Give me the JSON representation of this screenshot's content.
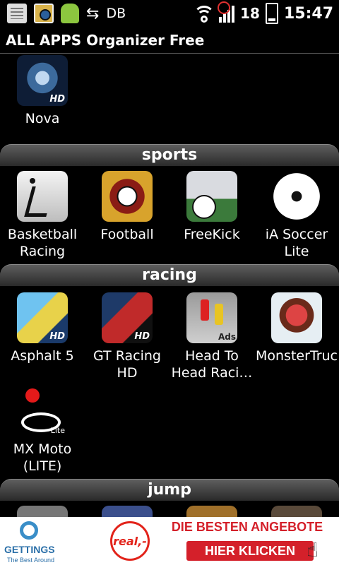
{
  "status_bar": {
    "left_icons": [
      "notes-icon",
      "photo-icon",
      "android-icon",
      "usb-icon"
    ],
    "carrier_text": "DB",
    "battery_level": "18",
    "time": "15:47"
  },
  "title_bar": {
    "title": "ALL APPS Organizer Free"
  },
  "top_apps": [
    {
      "label": "Nova",
      "badge": "HD"
    }
  ],
  "sections": [
    {
      "title": "sports",
      "apps": [
        {
          "label": "Basketball\nRacing"
        },
        {
          "label": "Football"
        },
        {
          "label": "FreeKick"
        },
        {
          "label": "iA Soccer\nLite"
        }
      ]
    },
    {
      "title": "racing",
      "apps": [
        {
          "label": "Asphalt 5",
          "badge": "HD"
        },
        {
          "label": "GT Racing\nHD",
          "badge": "HD"
        },
        {
          "label": "Head To\nHead Raci…",
          "badge": "Ads"
        },
        {
          "label": "MonsterTruc"
        },
        {
          "label": "MX Moto\n(LITE)",
          "badge": "Lite"
        }
      ]
    },
    {
      "title": "jump",
      "apps": []
    }
  ],
  "ad_banner": {
    "brand": "GETTINGS",
    "brand_tagline": "The Best Around",
    "partner_logo": "real,-",
    "headline": "DIE BESTEN ANGEBOTE",
    "cta": "HIER KLICKEN"
  },
  "colors": {
    "ad_red": "#d4202a",
    "background": "#000000"
  }
}
